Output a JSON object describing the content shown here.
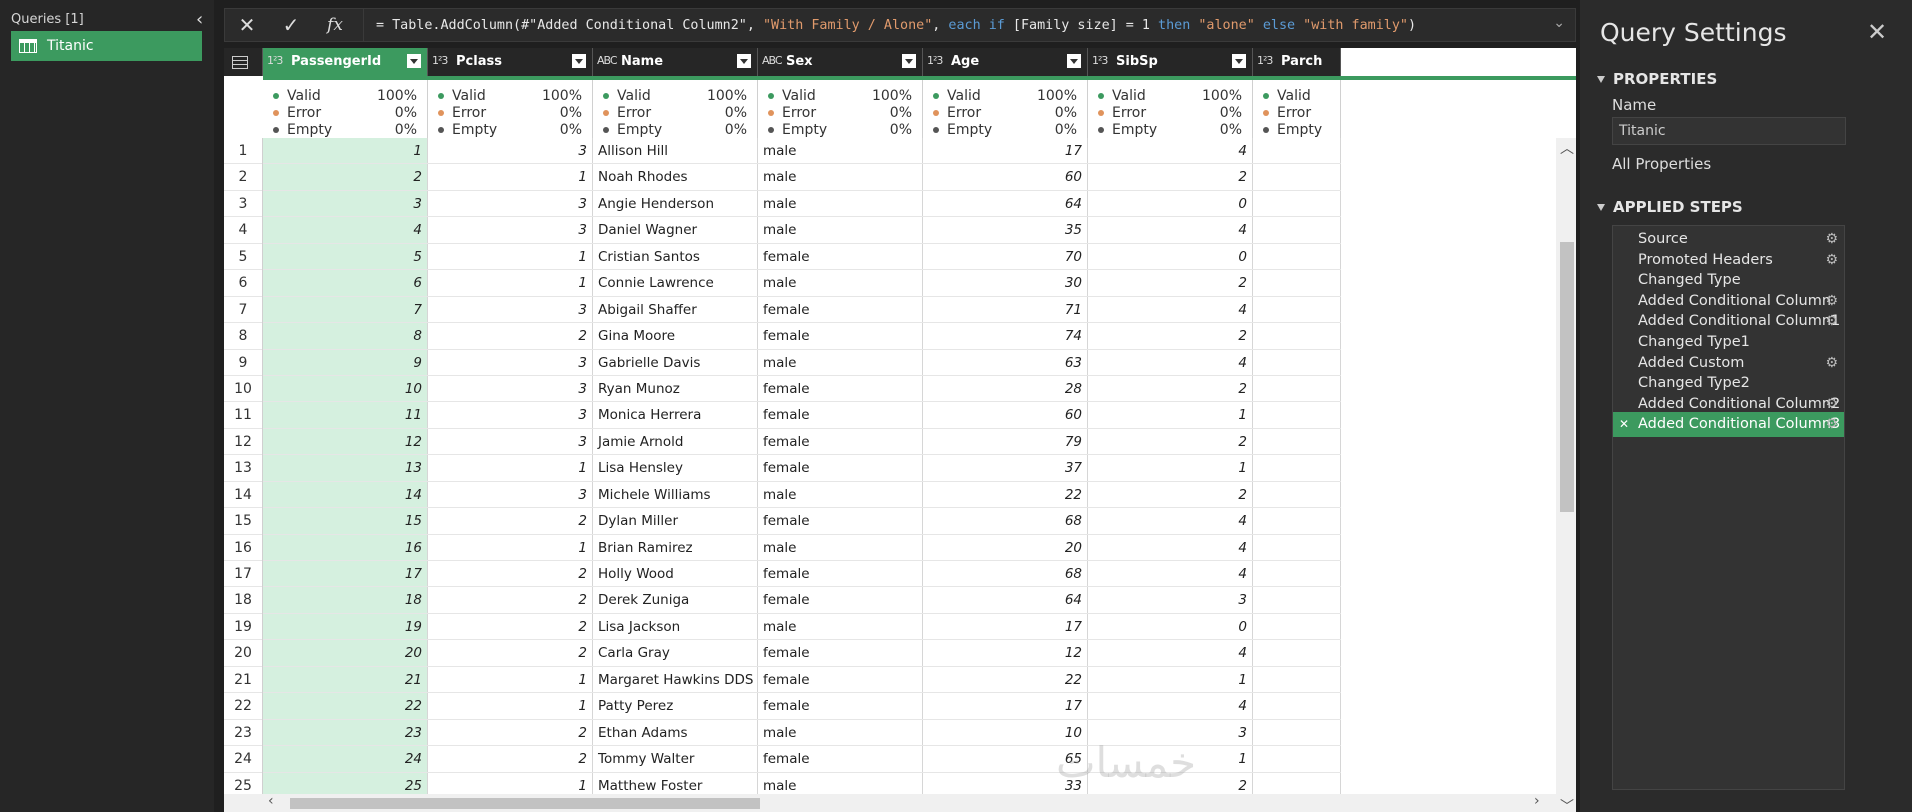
{
  "queries": {
    "header": "Queries [1]",
    "items": [
      {
        "label": "Titanic"
      }
    ]
  },
  "formula_bar": {
    "formula": "= Table.AddColumn(#\"Added Conditional Column2\", \"With Family / Alone\", each if [Family size] = 1 then \"alone\" else \"with family\")",
    "tokens": [
      {
        "t": "= Table.AddColumn(#\"Added Conditional Column2\", ",
        "c": ""
      },
      {
        "t": "\"With Family / Alone\"",
        "c": "str"
      },
      {
        "t": ", ",
        "c": ""
      },
      {
        "t": "each if",
        "c": "kw"
      },
      {
        "t": " [Family size] = 1 ",
        "c": ""
      },
      {
        "t": "then",
        "c": "kw"
      },
      {
        "t": " ",
        "c": ""
      },
      {
        "t": "\"alone\"",
        "c": "str"
      },
      {
        "t": " ",
        "c": ""
      },
      {
        "t": "else",
        "c": "kw"
      },
      {
        "t": " ",
        "c": ""
      },
      {
        "t": "\"with family\"",
        "c": "str"
      },
      {
        "t": ")",
        "c": ""
      }
    ],
    "cancel_icon": "close-icon",
    "commit_icon": "check-icon",
    "fx_label": "fx"
  },
  "columns": [
    {
      "name": "PassengerId",
      "type": "1²3",
      "selected": true
    },
    {
      "name": "Pclass",
      "type": "1²3"
    },
    {
      "name": "Name",
      "type": "ABC"
    },
    {
      "name": "Sex",
      "type": "ABC"
    },
    {
      "name": "Age",
      "type": "1²3"
    },
    {
      "name": "SibSp",
      "type": "1²3"
    },
    {
      "name": "Parch",
      "type": "1²3"
    }
  ],
  "profile": {
    "labels": [
      "Valid",
      "Error",
      "Empty"
    ],
    "colors": [
      "#3c9a5f",
      "#e0935c",
      "#555555"
    ],
    "values": [
      "100%",
      "0%",
      "0%"
    ]
  },
  "rows": [
    [
      "1",
      "3",
      "Allison Hill",
      "male",
      "17",
      "4"
    ],
    [
      "2",
      "1",
      "Noah Rhodes",
      "male",
      "60",
      "2"
    ],
    [
      "3",
      "3",
      "Angie Henderson",
      "male",
      "64",
      "0"
    ],
    [
      "4",
      "3",
      "Daniel Wagner",
      "male",
      "35",
      "4"
    ],
    [
      "5",
      "1",
      "Cristian Santos",
      "female",
      "70",
      "0"
    ],
    [
      "6",
      "1",
      "Connie Lawrence",
      "male",
      "30",
      "2"
    ],
    [
      "7",
      "3",
      "Abigail Shaffer",
      "female",
      "71",
      "4"
    ],
    [
      "8",
      "2",
      "Gina Moore",
      "female",
      "74",
      "2"
    ],
    [
      "9",
      "3",
      "Gabrielle Davis",
      "male",
      "63",
      "4"
    ],
    [
      "10",
      "3",
      "Ryan Munoz",
      "female",
      "28",
      "2"
    ],
    [
      "11",
      "3",
      "Monica Herrera",
      "female",
      "60",
      "1"
    ],
    [
      "12",
      "3",
      "Jamie Arnold",
      "female",
      "79",
      "2"
    ],
    [
      "13",
      "1",
      "Lisa Hensley",
      "female",
      "37",
      "1"
    ],
    [
      "14",
      "3",
      "Michele Williams",
      "male",
      "22",
      "2"
    ],
    [
      "15",
      "2",
      "Dylan Miller",
      "female",
      "68",
      "4"
    ],
    [
      "16",
      "1",
      "Brian Ramirez",
      "male",
      "20",
      "4"
    ],
    [
      "17",
      "2",
      "Holly Wood",
      "female",
      "68",
      "4"
    ],
    [
      "18",
      "2",
      "Derek Zuniga",
      "female",
      "64",
      "3"
    ],
    [
      "19",
      "2",
      "Lisa Jackson",
      "male",
      "17",
      "0"
    ],
    [
      "20",
      "2",
      "Carla Gray",
      "female",
      "12",
      "4"
    ],
    [
      "21",
      "1",
      "Margaret Hawkins DDS",
      "female",
      "22",
      "1"
    ],
    [
      "22",
      "1",
      "Patty Perez",
      "female",
      "17",
      "4"
    ],
    [
      "23",
      "2",
      "Ethan Adams",
      "male",
      "10",
      "3"
    ],
    [
      "24",
      "2",
      "Tommy Walter",
      "female",
      "65",
      "1"
    ],
    [
      "25",
      "1",
      "Matthew Foster",
      "male",
      "33",
      "2"
    ]
  ],
  "watermark": "خمسات",
  "settings": {
    "title": "Query Settings",
    "properties_header": "PROPERTIES",
    "name_label": "Name",
    "name_value": "Titanic",
    "all_properties": "All Properties",
    "applied_steps_header": "APPLIED STEPS",
    "steps": [
      {
        "label": "Source",
        "gear": true
      },
      {
        "label": "Promoted Headers",
        "gear": true
      },
      {
        "label": "Changed Type",
        "gear": false
      },
      {
        "label": "Added Conditional Column",
        "gear": true
      },
      {
        "label": "Added Conditional Column1",
        "gear": true
      },
      {
        "label": "Changed Type1",
        "gear": false
      },
      {
        "label": "Added Custom",
        "gear": true
      },
      {
        "label": "Changed Type2",
        "gear": false
      },
      {
        "label": "Added Conditional Column2",
        "gear": true
      },
      {
        "label": "Added Conditional Column3",
        "gear": true,
        "active": true
      }
    ]
  }
}
